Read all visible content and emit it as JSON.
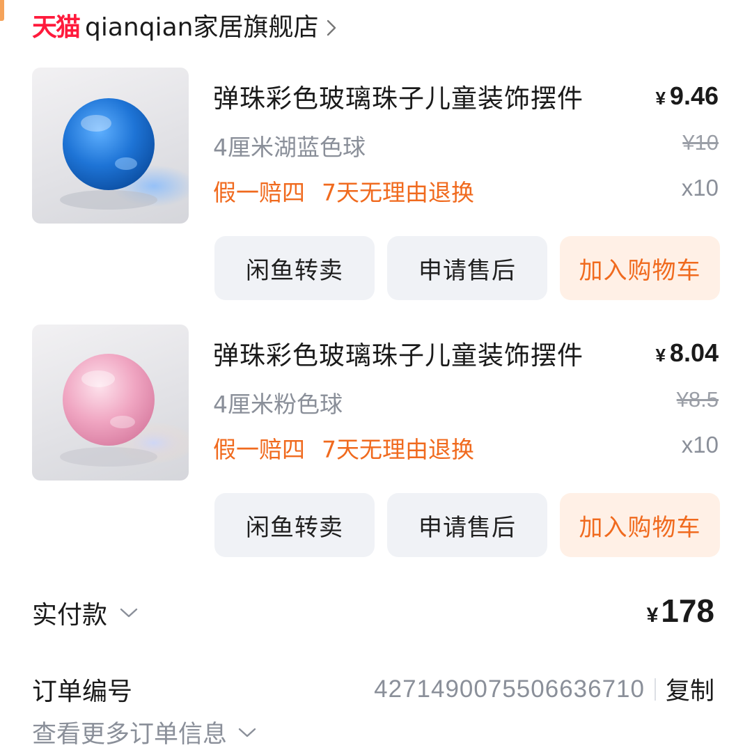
{
  "store": {
    "brand": "天猫",
    "name": "qianqian家居旗舰店"
  },
  "items": [
    {
      "title": "弹珠彩色玻璃珠子儿童装饰摆件",
      "price": "9.46",
      "currency": "¥",
      "original_price": "¥10",
      "spec": "4厘米湖蓝色球",
      "tags": [
        "假一赔四",
        "7天无理由退换"
      ],
      "quantity": "x10",
      "ball_color": "#1e74d6",
      "buttons": [
        "闲鱼转卖",
        "申请售后",
        "加入购物车"
      ]
    },
    {
      "title": "弹珠彩色玻璃珠子儿童装饰摆件",
      "price": "8.04",
      "currency": "¥",
      "original_price": "¥8.5",
      "spec": "4厘米粉色球",
      "tags": [
        "假一赔四",
        "7天无理由退换"
      ],
      "quantity": "x10",
      "ball_color": "#f0a6c2",
      "buttons": [
        "闲鱼转卖",
        "申请售后",
        "加入购物车"
      ]
    }
  ],
  "summary": {
    "paid_label": "实付款",
    "currency": "¥",
    "paid_amount": "178"
  },
  "order": {
    "label": "订单编号",
    "number": "4271490075506636710",
    "copy_label": "复制",
    "more_label": "查看更多订单信息"
  },
  "colors": {
    "brand_red": "#ff1a3c",
    "accent_orange": "#f06a1e",
    "button_gray": "#f0f2f6",
    "button_orange_bg": "#fff0e6",
    "muted_text": "#8a8f99"
  }
}
